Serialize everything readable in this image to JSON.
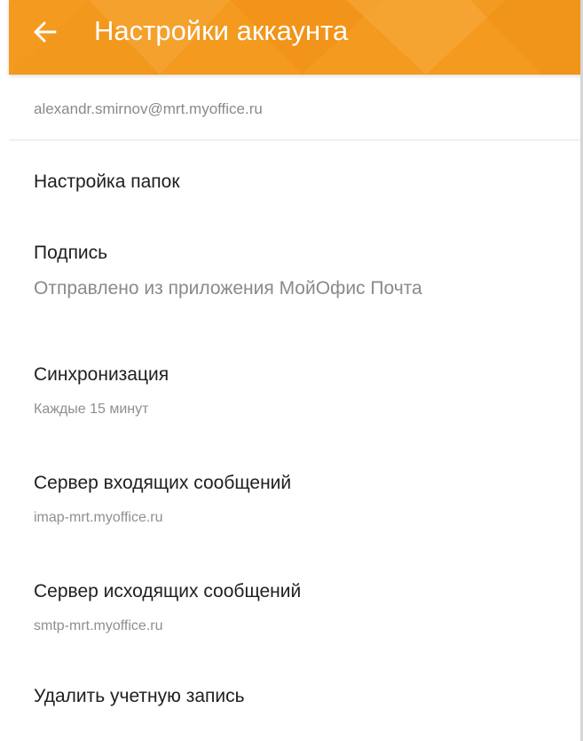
{
  "header": {
    "title": "Настройки аккаунта",
    "back_icon": "arrow-left-icon",
    "background_color": "#f39a1f"
  },
  "account": {
    "email": "alexandr.smirnov@mrt.myoffice.ru"
  },
  "settings": [
    {
      "title": "Настройка папок"
    },
    {
      "title": "Подпись",
      "value": "Отправлено из приложения МойОфис Почта"
    },
    {
      "title": "Синхронизация",
      "value": "Каждые 15 минут"
    },
    {
      "title": "Сервер входящих сообщений",
      "value": "imap-mrt.myoffice.ru"
    },
    {
      "title": "Сервер исходящих сообщений",
      "value": "smtp-mrt.myoffice.ru"
    },
    {
      "title": "Удалить учетную запись"
    }
  ]
}
